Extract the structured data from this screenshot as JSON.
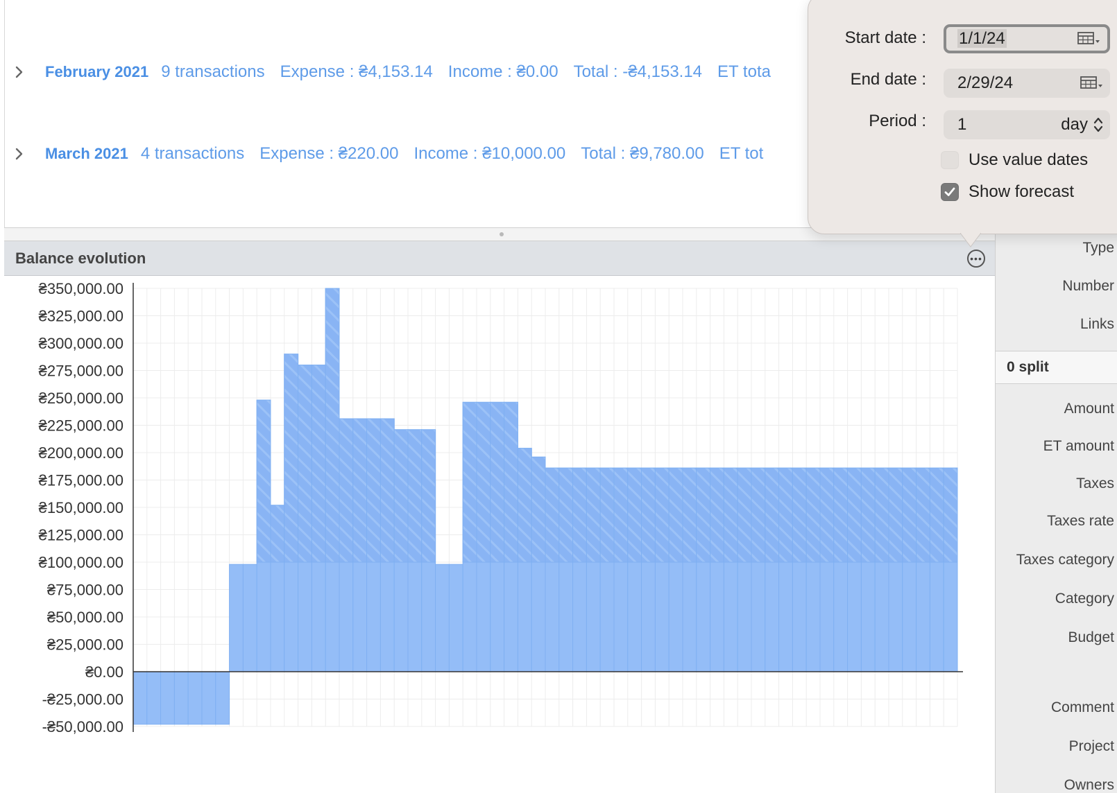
{
  "transactions": [
    {
      "month": "February 2021",
      "count": "9 transactions",
      "expense": "Expense : ₴4,153.14",
      "income": "Income : ₴0.00",
      "total": "Total : -₴4,153.14",
      "et": "ET tota"
    },
    {
      "month": "March 2021",
      "count": "4 transactions",
      "expense": "Expense : ₴220.00",
      "income": "Income : ₴10,000.00",
      "total": "Total : ₴9,780.00",
      "et": "ET tot"
    }
  ],
  "panel": {
    "title": "Balance evolution",
    "more_icon": "ellipsis-circle-icon"
  },
  "popover": {
    "start_label": "Start date :",
    "start_value": "1/1/24",
    "end_label": "End date :",
    "end_value": "2/29/24",
    "period_label": "Period :",
    "period_value": "1",
    "period_unit": "day",
    "use_value_dates": "Use value dates",
    "show_forecast": "Show forecast",
    "use_value_dates_checked": false,
    "show_forecast_checked": true
  },
  "inspector": {
    "labels_top": [
      "Type",
      "Number",
      "Links"
    ],
    "split_title": "0 split",
    "labels_bottom": [
      "Amount",
      "ET amount",
      "Taxes",
      "Taxes rate",
      "Taxes category",
      "Category",
      "Budget",
      "Comment",
      "Project",
      "Owners"
    ]
  },
  "colors": {
    "bar": "#94bdf7",
    "bar_edge": "#7fb0f2",
    "forecast": "#89b4f4",
    "link": "#4a8fe4"
  },
  "chart_data": {
    "type": "bar",
    "title": "Balance evolution",
    "xlabel": "",
    "ylabel": "",
    "ylim": [
      -50000,
      350000
    ],
    "yticks": [
      350000,
      325000,
      300000,
      275000,
      250000,
      225000,
      200000,
      175000,
      150000,
      125000,
      100000,
      75000,
      50000,
      25000,
      0,
      -25000,
      -50000
    ],
    "ytick_labels": [
      "₴350,000.00",
      "₴325,000.00",
      "₴300,000.00",
      "₴275,000.00",
      "₴250,000.00",
      "₴225,000.00",
      "₴200,000.00",
      "₴175,000.00",
      "₴150,000.00",
      "₴125,000.00",
      "₴100,000.00",
      "₴75,000.00",
      "₴50,000.00",
      "₴25,000.00",
      "₴0.00",
      "-₴25,000.00",
      "-₴50,000.00"
    ],
    "grid": true,
    "series": [
      {
        "values": [
          -48000,
          -48000,
          -48000,
          -48000,
          -48000,
          -48000,
          -48000,
          98000,
          98000,
          248000,
          152000,
          290000,
          280000,
          280000,
          350000,
          231000,
          231000,
          231000,
          231000,
          221000,
          221000,
          221000,
          98000,
          98000,
          246000,
          246000,
          246000,
          246000,
          204000,
          196000,
          186000,
          186000,
          186000,
          186000,
          186000,
          186000,
          186000,
          186000,
          186000,
          186000,
          186000,
          186000,
          186000,
          186000,
          186000,
          186000,
          186000,
          186000,
          186000,
          186000,
          186000,
          186000,
          186000,
          186000,
          186000,
          186000,
          186000,
          186000,
          186000,
          186000
        ]
      }
    ]
  }
}
